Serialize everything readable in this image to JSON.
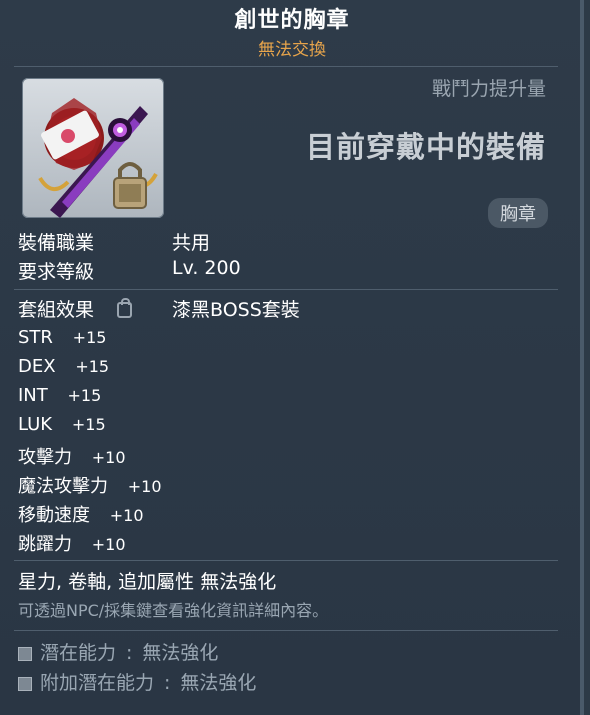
{
  "item": {
    "name": "創世的胸章",
    "trade_status": "無法交換",
    "power_label": "戰鬥力提升量",
    "equipped_text": "目前穿戴中的裝備",
    "category": "胸章"
  },
  "requirements": {
    "job_label": "裝備職業",
    "job_value": "共用",
    "level_label": "要求等級",
    "level_value": "Lv. 200"
  },
  "set": {
    "label": "套組效果",
    "value": "漆黑BOSS套裝"
  },
  "stats": [
    {
      "name": "STR",
      "value": "+15"
    },
    {
      "name": "DEX",
      "value": "+15"
    },
    {
      "name": "INT",
      "value": "+15"
    },
    {
      "name": "LUK",
      "value": "+15"
    },
    {
      "name": "攻擊力",
      "value": "+10"
    },
    {
      "name": "魔法攻擊力",
      "value": "+10"
    },
    {
      "name": "移動速度",
      "value": "+10"
    },
    {
      "name": "跳躍力",
      "value": "+10"
    }
  ],
  "notes": {
    "no_enhance": "星力, 卷軸, 追加屬性 無法強化",
    "hint": "可透過NPC/採集鍵查看強化資訊詳細內容。"
  },
  "potential": {
    "label": "潛在能力",
    "value": "無法強化",
    "bonus_label": "附加潛在能力",
    "bonus_value": "無法強化",
    "separator": ":"
  },
  "icons": {
    "item": "emblem-icon",
    "lock": "lock-icon",
    "set_lock": "set-lock-icon"
  },
  "colors": {
    "background": "#2d3a47",
    "trade": "#e7a44b",
    "muted": "#9aa7b3"
  }
}
